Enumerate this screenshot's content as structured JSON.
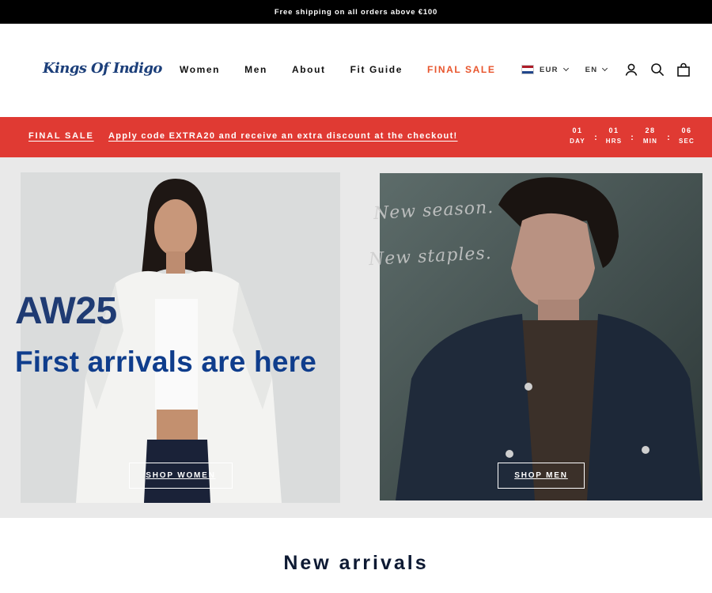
{
  "announcement": "Free shipping on all orders above €100",
  "header": {
    "logo": "Kings Of Indigo",
    "nav": [
      "Women",
      "Men",
      "About",
      "Fit Guide",
      "FINAL SALE"
    ],
    "currency": "EUR",
    "language": "EN"
  },
  "sale_banner": {
    "label": "FINAL SALE",
    "message": "Apply code EXTRA20 and receive an extra discount at the checkout!",
    "countdown": [
      {
        "value": "01",
        "unit": "DAY"
      },
      {
        "value": "01",
        "unit": "HRS"
      },
      {
        "value": "28",
        "unit": "MIN"
      },
      {
        "value": "06",
        "unit": "SEC"
      }
    ]
  },
  "hero": {
    "title": "AW25",
    "subtitle": "First arrivals are here",
    "script_line_1": "New season.",
    "script_line_2": "New staples.",
    "cta_women": "SHOP WOMEN",
    "cta_men": "SHOP MEN"
  },
  "section": {
    "title": "New arrivals"
  },
  "colors": {
    "accent_sale": "#e03a33",
    "nav_sale": "#e8552d",
    "brand_blue": "#1f3b73"
  },
  "icons": [
    "flag-nl-icon",
    "chevron-down-icon",
    "account-icon",
    "search-icon",
    "bag-icon"
  ]
}
